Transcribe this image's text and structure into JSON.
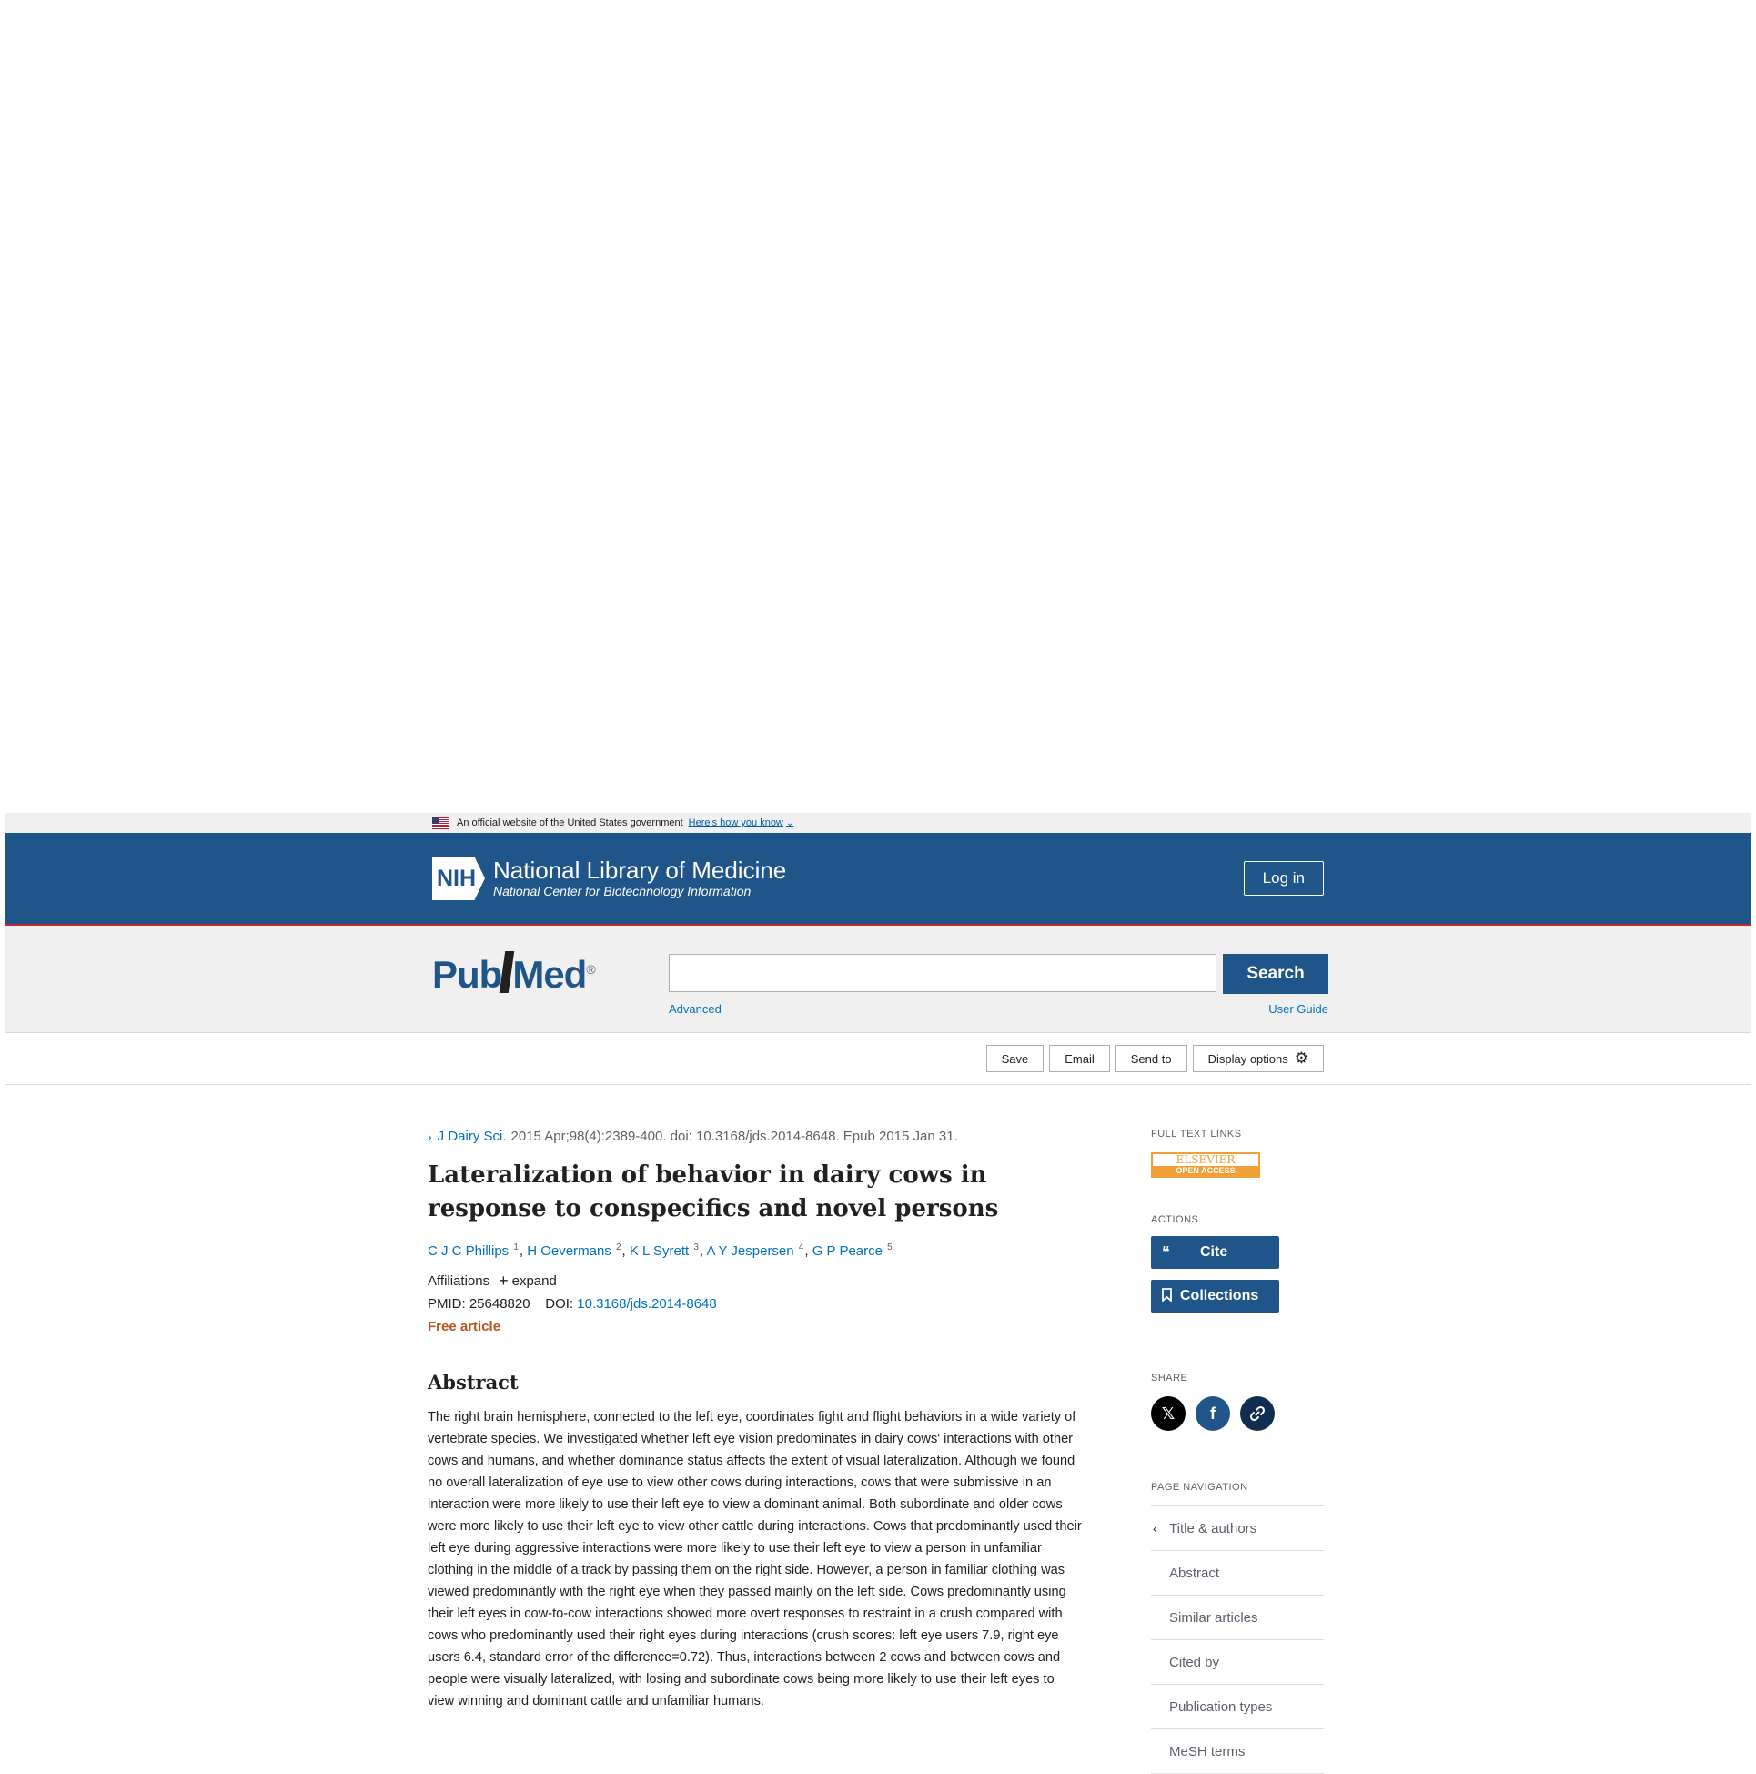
{
  "gov_banner": {
    "text": "An official website of the United States government",
    "link": "Here's how you know"
  },
  "nih": {
    "mark": "NIH",
    "title": "National Library of Medicine",
    "subtitle": "National Center for Biotechnology Information",
    "login": "Log in"
  },
  "pubmed": {
    "logo_pub": "Pub",
    "logo_med": "Med",
    "logo_reg": "®",
    "search_value": "",
    "search_button": "Search",
    "advanced": "Advanced",
    "user_guide": "User Guide"
  },
  "actionbar": {
    "save": "Save",
    "email": "Email",
    "send_to": "Send to",
    "display_options": "Display options"
  },
  "article": {
    "journal": "J Dairy Sci.",
    "citation": "2015 Apr;98(4):2389-400. doi: 10.3168/jds.2014-8648. Epub 2015 Jan 31.",
    "title": "Lateralization of behavior in dairy cows in response to conspecifics and novel persons",
    "authors": [
      {
        "name": "C J C Phillips",
        "sup": "1"
      },
      {
        "name": "H Oevermans",
        "sup": "2"
      },
      {
        "name": "K L Syrett",
        "sup": "3"
      },
      {
        "name": "A Y Jespersen",
        "sup": "4"
      },
      {
        "name": "G P Pearce",
        "sup": "5"
      }
    ],
    "affiliations_label": "Affiliations",
    "expand_label": "expand",
    "pmid_label": "PMID: 25648820",
    "doi_label": "DOI:",
    "doi_value": "10.3168/jds.2014-8648",
    "free_article": "Free article",
    "abstract_heading": "Abstract",
    "abstract_text": "The right brain hemisphere, connected to the left eye, coordinates fight and flight behaviors in a wide variety of vertebrate species. We investigated whether left eye vision predominates in dairy cows' interactions with other cows and humans, and whether dominance status affects the extent of visual lateralization. Although we found no overall lateralization of eye use to view other cows during interactions, cows that were submissive in an interaction were more likely to use their left eye to view a dominant animal. Both subordinate and older cows were more likely to use their left eye to view other cattle during interactions. Cows that predominantly used their left eye during aggressive interactions were more likely to use their left eye to view a person in unfamiliar clothing in the middle of a track by passing them on the right side. However, a person in familiar clothing was viewed predominantly with the right eye when they passed mainly on the left side. Cows predominantly using their left eyes in cow-to-cow interactions showed more overt responses to restraint in a crush compared with cows who predominantly used their right eyes during interactions (crush scores: left eye users 7.9, right eye users 6.4, standard error of the difference=0.72). Thus, interactions between 2 cows and between cows and people were visually lateralized, with losing and subordinate cows being more likely to use their left eyes to view winning and dominant cattle and unfamiliar humans."
  },
  "sidebar": {
    "full_text_links": "FULL TEXT LINKS",
    "elsevier_top": "ELSEVIER",
    "elsevier_bottom": "OPEN ACCESS",
    "actions": "ACTIONS",
    "cite": "Cite",
    "collections": "Collections",
    "share": "SHARE",
    "page_navigation": "PAGE NAVIGATION",
    "nav_items": [
      "Title & authors",
      "Abstract",
      "Similar articles",
      "Cited by",
      "Publication types",
      "MeSH terms"
    ]
  },
  "colors": {
    "nih_blue": "#20558a",
    "link_blue": "#0071bc",
    "free_orange": "#b5541c",
    "elsevier_orange": "#f0a037"
  }
}
